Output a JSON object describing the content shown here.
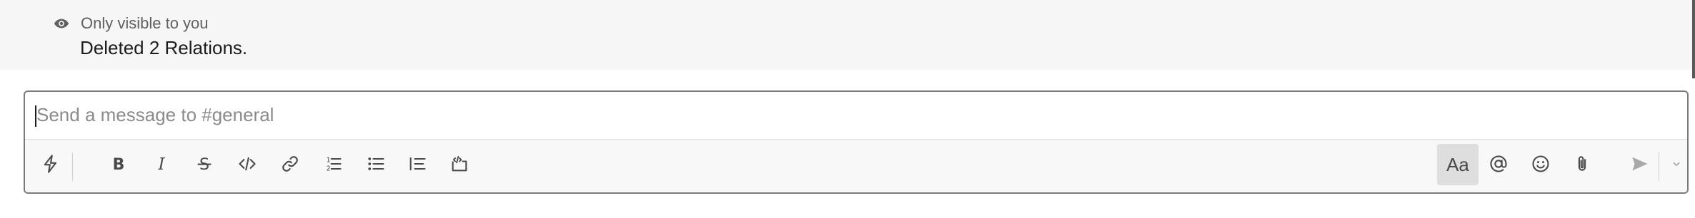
{
  "ephemeral_message": {
    "visibility_label": "Only visible to you",
    "text": "Deleted 2 Relations."
  },
  "composer": {
    "placeholder": "Send a message to #general",
    "toolbar": {
      "shortcuts_icon": "lightning-icon",
      "formatting": [
        "bold-icon",
        "italic-icon",
        "strikethrough-icon",
        "code-icon",
        "link-icon",
        "ordered-list-icon",
        "bulleted-list-icon",
        "blockquote-icon",
        "code-block-icon"
      ],
      "text_format_label": "Aa",
      "right_actions": [
        "mention-icon",
        "emoji-icon",
        "attachment-icon",
        "send-icon",
        "chevron-down-icon"
      ]
    }
  }
}
